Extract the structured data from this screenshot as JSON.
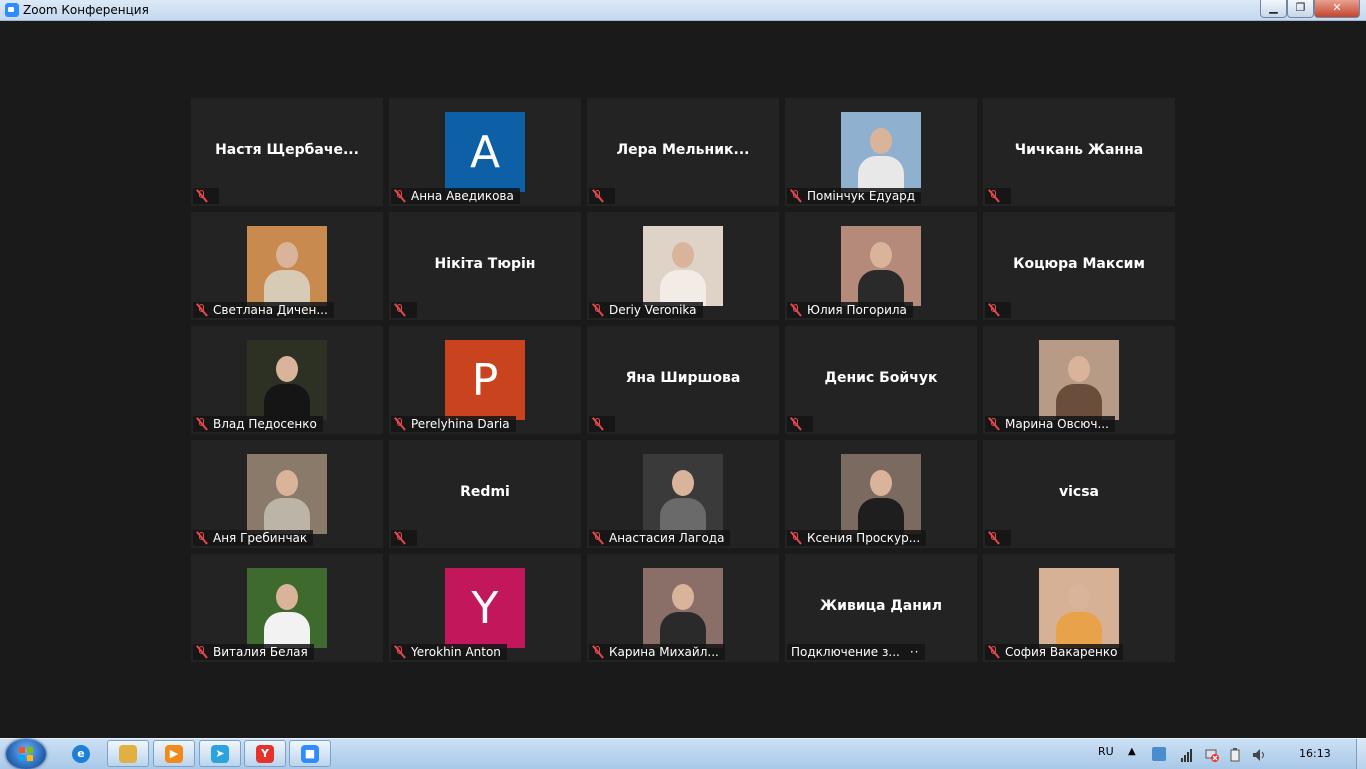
{
  "window": {
    "title": "Zoom Конференция"
  },
  "participants": [
    {
      "name": "Настя Щербаче...",
      "label": "",
      "kind": "name"
    },
    {
      "name": "",
      "label": "Анна Аведикова",
      "kind": "avatar",
      "letter": "A",
      "color": "#0d5fa6"
    },
    {
      "name": "Лера Мельник...",
      "label": "",
      "kind": "name"
    },
    {
      "name": "",
      "label": "Помінчук Едуард",
      "kind": "photo",
      "bg": "#8fb0cf",
      "body": "#e8e8e8"
    },
    {
      "name": "Чичкань Жанна",
      "label": "",
      "kind": "name"
    },
    {
      "name": "",
      "label": "Светлана Дичен...",
      "kind": "photo",
      "bg": "#c98a50",
      "body": "#d8cbb6"
    },
    {
      "name": "Нікіта Тюрін",
      "label": "",
      "kind": "name"
    },
    {
      "name": "",
      "label": "Deriy Veronika",
      "kind": "photo",
      "bg": "#dfd3c8",
      "body": "#f3ece6"
    },
    {
      "name": "",
      "label": "Юлия Погорила",
      "kind": "photo",
      "bg": "#b58a7a",
      "body": "#2a2a2a"
    },
    {
      "name": "Коцюра Максим",
      "label": "",
      "kind": "name"
    },
    {
      "name": "",
      "label": "Влад Педосенко",
      "kind": "photo",
      "bg": "#2c3124",
      "body": "#151515"
    },
    {
      "name": "",
      "label": "Perelyhina Daria",
      "kind": "avatar",
      "letter": "P",
      "color": "#c8431e"
    },
    {
      "name": "Яна Ширшова",
      "label": "",
      "kind": "name"
    },
    {
      "name": "Денис Бойчук",
      "label": "",
      "kind": "name"
    },
    {
      "name": "",
      "label": "Марина Овсюч...",
      "kind": "photo",
      "bg": "#b79b86",
      "body": "#6b4d3c"
    },
    {
      "name": "",
      "label": "Аня Гребинчак",
      "kind": "photo",
      "bg": "#8a7a6a",
      "body": "#bdb4a8"
    },
    {
      "name": "Redmi",
      "label": "",
      "kind": "name"
    },
    {
      "name": "",
      "label": "Анастасия Лагода",
      "kind": "photo",
      "bg": "#3a3a3a",
      "body": "#6a6a6a"
    },
    {
      "name": "",
      "label": "Ксения Проскур...",
      "kind": "photo",
      "bg": "#7a6a60",
      "body": "#1e1e1e"
    },
    {
      "name": "vicsa",
      "label": "",
      "kind": "name"
    },
    {
      "name": "",
      "label": "Виталия Белая",
      "kind": "photo",
      "bg": "#3e6a2e",
      "body": "#f2f2f2"
    },
    {
      "name": "",
      "label": "Yerokhin Anton",
      "kind": "avatar",
      "letter": "Y",
      "color": "#c2185b"
    },
    {
      "name": "",
      "label": "Карина Михайл...",
      "kind": "photo",
      "bg": "#8a6f68",
      "body": "#2a2a2a"
    },
    {
      "name": "Живица Данил",
      "label": "Подключение з...",
      "kind": "name",
      "connecting": true
    },
    {
      "name": "",
      "label": "София Вакаренко",
      "kind": "photo",
      "bg": "#d7b196",
      "body": "#e8a24a"
    }
  ],
  "tray": {
    "lang": "RU",
    "time": "16:13"
  },
  "taskbar_apps": [
    {
      "icon": "internet-explorer-icon",
      "color": "#1e7fd8",
      "glyph": "e"
    },
    {
      "icon": "file-explorer-icon",
      "color": "#e0b040",
      "glyph": ""
    },
    {
      "icon": "media-player-icon",
      "color": "#f08a1a",
      "glyph": "▶"
    },
    {
      "icon": "telegram-icon",
      "color": "#2aa3de",
      "glyph": "➤"
    },
    {
      "icon": "yandex-browser-icon",
      "color": "#e4322d",
      "glyph": "Y"
    },
    {
      "icon": "zoom-icon",
      "color": "#2d8cff",
      "glyph": "■"
    }
  ]
}
